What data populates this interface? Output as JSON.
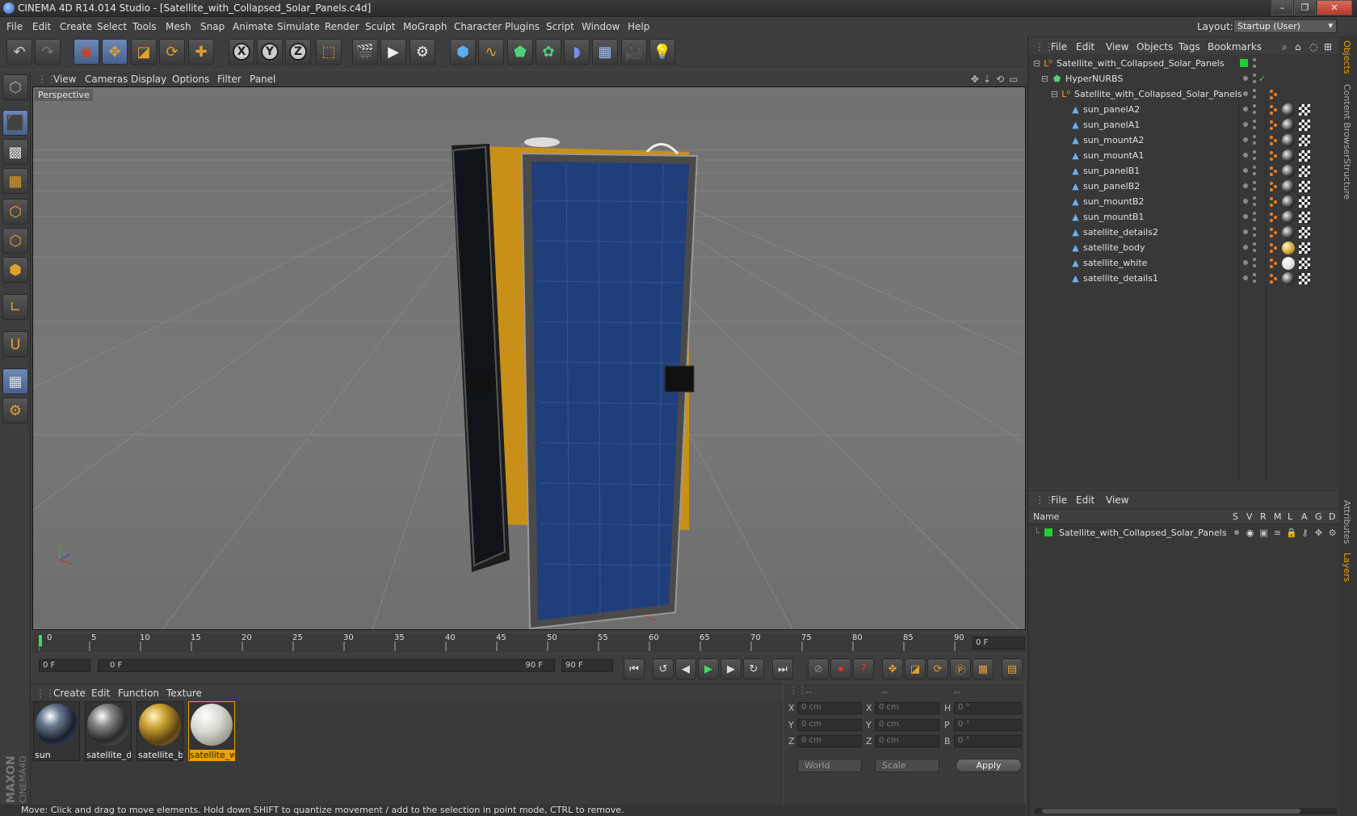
{
  "window": {
    "title": "CINEMA 4D R14.014 Studio - [Satellite_with_Collapsed_Solar_Panels.c4d]",
    "minimize_glyph": "–",
    "restore_glyph": "❐",
    "close_glyph": "✕"
  },
  "menubar": {
    "items": [
      "File",
      "Edit",
      "Create",
      "Select",
      "Tools",
      "Mesh",
      "Snap",
      "Animate",
      "Simulate",
      "Render",
      "Sculpt",
      "MoGraph",
      "Character",
      "Plugins",
      "Script",
      "Window",
      "Help"
    ],
    "layout_label": "Layout:",
    "layout_value": "Startup (User)"
  },
  "toolbar": {
    "icons": [
      "undo-icon",
      "redo-icon",
      "live-select-icon",
      "move-icon",
      "scale-icon",
      "rotate-icon",
      "add-icon",
      "x-axis-icon",
      "y-axis-icon",
      "z-axis-icon",
      "coordinate-system-icon",
      "render-view-icon",
      "render-picture-viewer-icon",
      "render-settings-icon",
      "cube-icon",
      "spline-icon",
      "nurbs-icon",
      "array-icon",
      "deformer-icon",
      "floor-icon",
      "camera-icon",
      "light-icon"
    ],
    "axis_labels": [
      "X",
      "Y",
      "Z"
    ]
  },
  "left_tools": [
    "make-editable-icon",
    "model-mode-icon",
    "texture-mode-icon",
    "workplane-icon",
    "points-mode-icon",
    "edges-mode-icon",
    "polygons-mode-icon",
    "axis-mode-icon",
    "magnet-icon",
    "snap-grid-icon",
    "snap-settings-icon"
  ],
  "viewport": {
    "menu": [
      "View",
      "Cameras",
      "Display",
      "Options",
      "Filter",
      "Panel"
    ],
    "label": "Perspective"
  },
  "timeline": {
    "ticks": [
      "0",
      "5",
      "10",
      "15",
      "20",
      "25",
      "30",
      "35",
      "40",
      "45",
      "50",
      "55",
      "60",
      "65",
      "70",
      "75",
      "80",
      "85",
      "90"
    ],
    "current_frame": "0 F"
  },
  "transport": {
    "start": "0 F",
    "range_start": "0 F",
    "range_end": "90 F",
    "end": "90 F"
  },
  "material_manager": {
    "menu": [
      "Create",
      "Edit",
      "Function",
      "Texture"
    ],
    "materials": [
      {
        "name": "sun",
        "selected": false
      },
      {
        "name": "satellite_de",
        "selected": false
      },
      {
        "name": "satellite_bc",
        "selected": false
      },
      {
        "name": "satellite_wl",
        "selected": true
      }
    ]
  },
  "coordinates": {
    "headers": [
      "--",
      "--",
      "--"
    ],
    "rows": [
      {
        "axis": "X",
        "pos": "0 cm",
        "axis2": "X",
        "size": "0 cm",
        "rot_label": "H",
        "rot": "0 °"
      },
      {
        "axis": "Y",
        "pos": "0 cm",
        "axis2": "Y",
        "size": "0 cm",
        "rot_label": "P",
        "rot": "0 °"
      },
      {
        "axis": "Z",
        "pos": "0 cm",
        "axis2": "Z",
        "size": "0 cm",
        "rot_label": "B",
        "rot": "0 °"
      }
    ],
    "mode": "World",
    "transform": "Scale",
    "apply": "Apply"
  },
  "status": "Move: Click and drag to move elements. Hold down SHIFT to quantize movement / add to the selection in point mode, CTRL to remove.",
  "object_manager": {
    "menu": [
      "File",
      "Edit",
      "View",
      "Objects",
      "Tags",
      "Bookmarks"
    ],
    "objects": [
      {
        "name": "Satellite_with_Collapsed_Solar_Panels",
        "level": 0,
        "kind": "null"
      },
      {
        "name": "HyperNURBS",
        "level": 1,
        "kind": "nurbs"
      },
      {
        "name": "Satellite_with_Collapsed_Solar_Panels",
        "level": 2,
        "kind": "null"
      },
      {
        "name": "sun_panelA2",
        "level": 3,
        "kind": "poly"
      },
      {
        "name": "sun_panelA1",
        "level": 3,
        "kind": "poly"
      },
      {
        "name": "sun_mountA2",
        "level": 3,
        "kind": "poly"
      },
      {
        "name": "sun_mountA1",
        "level": 3,
        "kind": "poly"
      },
      {
        "name": "sun_panelB1",
        "level": 3,
        "kind": "poly"
      },
      {
        "name": "sun_panelB2",
        "level": 3,
        "kind": "poly"
      },
      {
        "name": "sun_mountB2",
        "level": 3,
        "kind": "poly"
      },
      {
        "name": "sun_mountB1",
        "level": 3,
        "kind": "poly"
      },
      {
        "name": "satellite_details2",
        "level": 3,
        "kind": "poly"
      },
      {
        "name": "satellite_body",
        "level": 3,
        "kind": "poly"
      },
      {
        "name": "satellite_white",
        "level": 3,
        "kind": "poly"
      },
      {
        "name": "satellite_details1",
        "level": 3,
        "kind": "poly"
      }
    ]
  },
  "layer_manager": {
    "menu": [
      "File",
      "Edit",
      "View"
    ],
    "header_name": "Name",
    "columns": [
      "S",
      "V",
      "R",
      "M",
      "L",
      "A",
      "G",
      "D"
    ],
    "layers": [
      {
        "name": "Satellite_with_Collapsed_Solar_Panels",
        "color": "#22cc33"
      }
    ]
  },
  "side_tabs": [
    "Objects",
    "Content Browser",
    "Structure",
    "Attributes",
    "Layers"
  ],
  "colors": {
    "accent": "#f0a000",
    "selection": "#5a7ab0",
    "layer_green": "#22cc33"
  }
}
